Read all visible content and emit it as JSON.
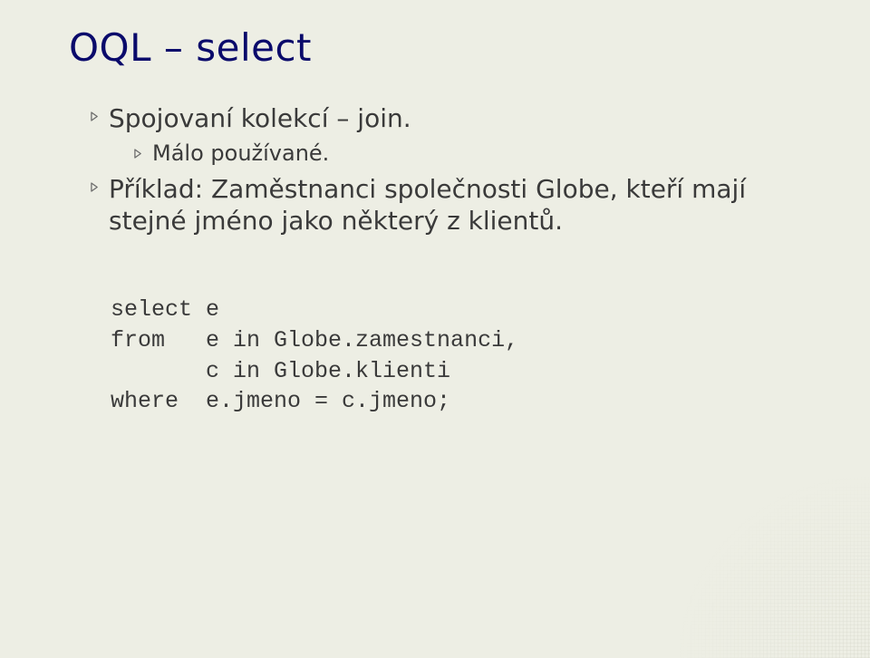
{
  "title": "OQL – select",
  "bullets": {
    "b1": "Spojovaní kolekcí – join.",
    "b2": "Málo používané.",
    "b3": "Příklad: Zaměstnanci společnosti Globe, kteří mají stejné jméno jako některý z klientů."
  },
  "code": {
    "l1": "select e",
    "l2": "from   e in Globe.zamestnanci,",
    "l3": "       c in Globe.klienti",
    "l4": "where  e.jmeno = c.jmeno;"
  }
}
